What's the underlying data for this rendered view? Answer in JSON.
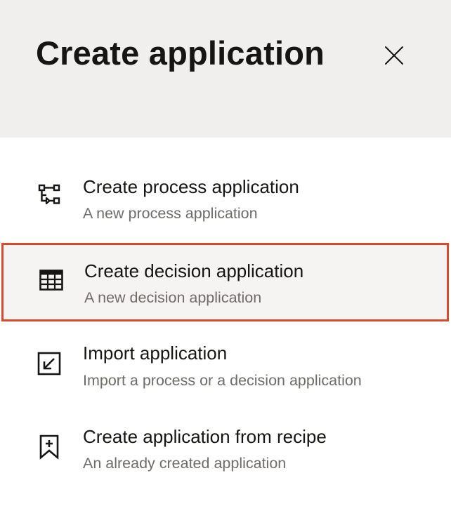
{
  "dialog": {
    "title": "Create application",
    "close_icon": "close-icon"
  },
  "options": [
    {
      "title": "Create process application",
      "description": "A new process application",
      "icon": "process-flow-icon",
      "selected": false
    },
    {
      "title": "Create decision application",
      "description": "A new decision application",
      "icon": "table-grid-icon",
      "selected": true
    },
    {
      "title": "Import application",
      "description": "Import a process or a decision application",
      "icon": "import-arrow-icon",
      "selected": false
    },
    {
      "title": "Create application from recipe",
      "description": "An already created application",
      "icon": "bookmark-plus-icon",
      "selected": false
    }
  ],
  "colors": {
    "header_bg": "#f1efed",
    "selected_border": "#d9492e",
    "selected_bg": "#f5f4f2",
    "title_text": "#161513",
    "description_text": "#6f6b66"
  }
}
